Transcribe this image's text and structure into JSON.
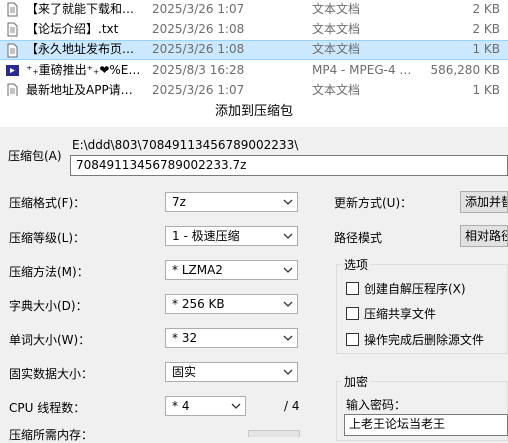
{
  "files": [
    {
      "name": "【来了就能下载和…",
      "date": "2025/3/26 1:07",
      "type": "文本文档",
      "size": "2 KB",
      "icon": "text-file-icon"
    },
    {
      "name": "【论坛介绍】.txt",
      "date": "2025/3/26 1:08",
      "type": "文本文档",
      "size": "2 KB",
      "icon": "text-file-icon"
    },
    {
      "name": "【永久地址发布页…",
      "date": "2025/3/26 1:08",
      "type": "文本文档",
      "size": "1 KB",
      "icon": "text-file-icon",
      "selected": true
    },
    {
      "name": "⁺₊重磅推出⁺₊❤%E…",
      "date": "2025/8/3 16:28",
      "type": "MP4 - MPEG-4 …",
      "size": "586,280 KB",
      "icon": "mp4-file-icon"
    },
    {
      "name": "最新地址及APP请…",
      "date": "2025/3/26 1:07",
      "type": "文本文档",
      "size": "1 KB",
      "icon": "text-file-icon"
    }
  ],
  "dialog": {
    "title": "添加到压缩包",
    "archive_label": "压缩包(A)",
    "archive_path": "E:\\ddd\\803\\70849113456789002233\\",
    "archive_name": "70849113456789002233.7z",
    "format_label": "压缩格式(F)：",
    "format_value": "7z",
    "level_label": "压缩等级(L)：",
    "level_value": "1 - 极速压缩",
    "method_label": "压缩方法(M)：",
    "method_value": "* LZMA2",
    "dict_label": "字典大小(D)：",
    "dict_value": "* 256 KB",
    "word_label": "单词大小(W)：",
    "word_value": "* 32",
    "solid_label": "固实数据大小：",
    "solid_value": "固实",
    "cpu_label": "CPU 线程数：",
    "cpu_value": "* 4",
    "cpu_max": "/ 4",
    "mem_label": "压缩所需内存：",
    "update_label": "更新方式(U)：",
    "update_value": "添加并替",
    "path_label": "路径模式",
    "path_value": "相对路径",
    "options_title": "选项",
    "opt_sfx": "创建自解压程序(X)",
    "opt_shared": "压缩共享文件",
    "opt_delete": "操作完成后删除源文件",
    "encrypt_title": "加密",
    "password_label": "输入密码：",
    "password_value": "上老王论坛当老王"
  }
}
